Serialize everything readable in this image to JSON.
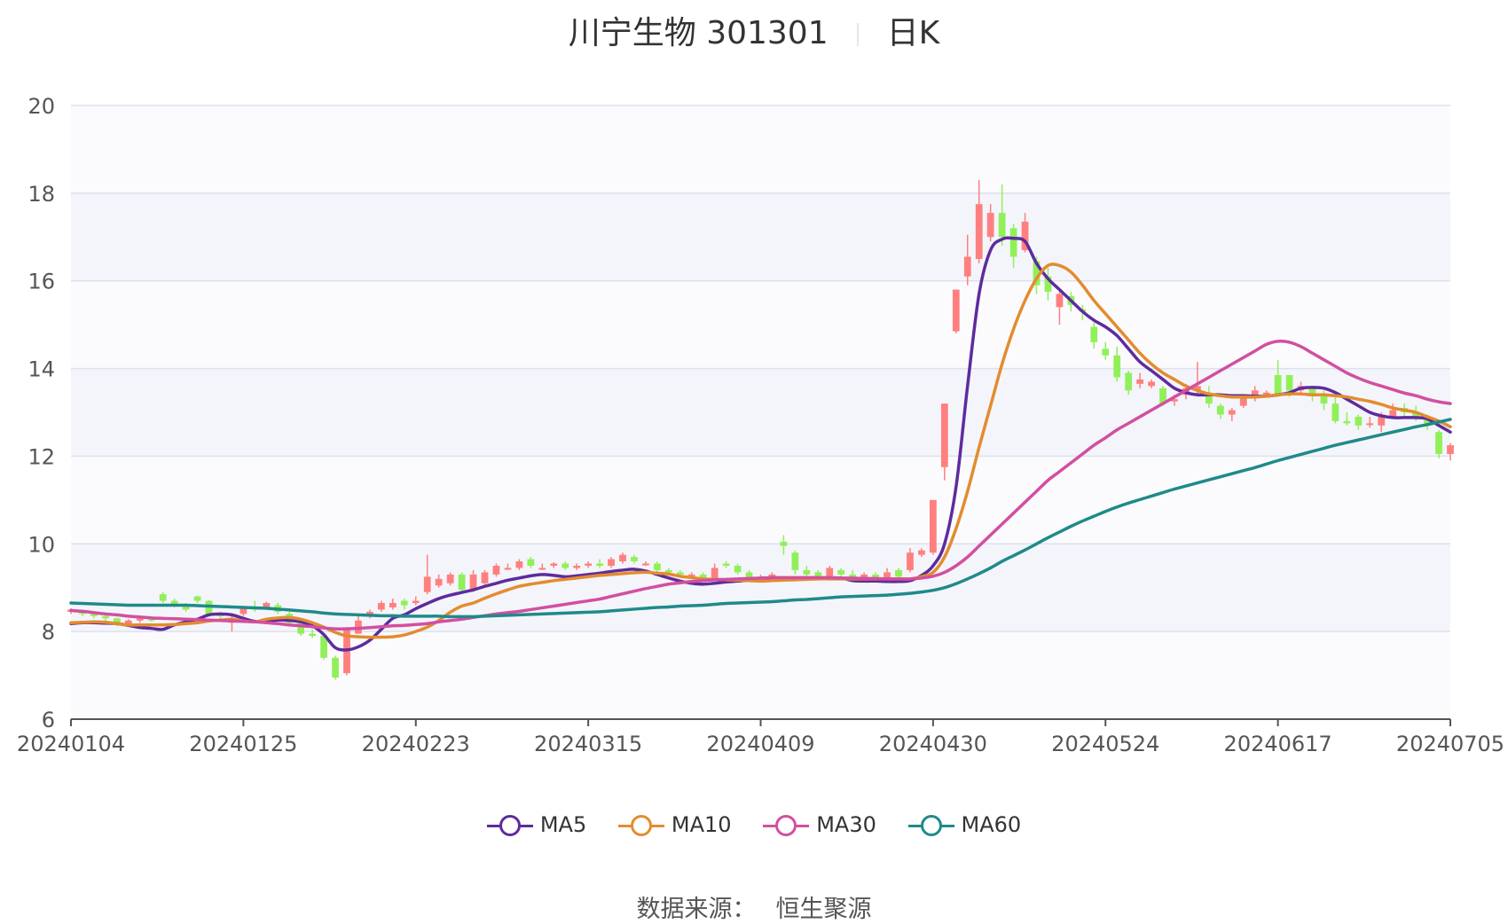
{
  "header": {
    "name": "川宁生物 301301",
    "period": "日K"
  },
  "source": {
    "label": "数据来源：",
    "value": "恒生聚源"
  },
  "colors": {
    "up": "#ff7f7f",
    "down": "#91f05a",
    "ma5": "#5e2b9e",
    "ma10": "#e38c2e",
    "ma30": "#d24fa0",
    "ma60": "#1f8a8a"
  },
  "chart_data": {
    "type": "candlestick",
    "title": "川宁生物 301301",
    "subtitle": "日K",
    "ylim": [
      6,
      20
    ],
    "yticks": [
      6,
      8,
      10,
      12,
      14,
      16,
      18,
      20
    ],
    "grid": true,
    "legend_position": "bottom",
    "x_tick_labels": [
      "20240104",
      "20240125",
      "20240223",
      "20240315",
      "20240409",
      "20240430",
      "20240524",
      "20240617",
      "20240705"
    ],
    "x_tick_index": [
      0,
      15,
      30,
      45,
      60,
      75,
      90,
      105,
      120
    ],
    "candles": [
      [
        8.45,
        8.5,
        8.4,
        8.53
      ],
      [
        8.45,
        8.4,
        8.35,
        8.48
      ],
      [
        8.4,
        8.35,
        8.3,
        8.43
      ],
      [
        8.35,
        8.3,
        8.25,
        8.4
      ],
      [
        8.3,
        8.15,
        8.12,
        8.32
      ],
      [
        8.15,
        8.25,
        8.1,
        8.28
      ],
      [
        8.25,
        8.3,
        8.2,
        8.33
      ],
      [
        8.3,
        8.25,
        8.22,
        8.32
      ],
      [
        8.85,
        8.7,
        8.65,
        8.9
      ],
      [
        8.7,
        8.6,
        8.55,
        8.75
      ],
      [
        8.6,
        8.5,
        8.45,
        8.65
      ],
      [
        8.8,
        8.7,
        8.65,
        8.82
      ],
      [
        8.7,
        8.4,
        8.35,
        8.72
      ],
      [
        8.4,
        8.35,
        8.3,
        8.45
      ],
      [
        8.2,
        8.3,
        8.0,
        8.35
      ],
      [
        8.4,
        8.55,
        8.35,
        8.58
      ],
      [
        8.55,
        8.5,
        8.45,
        8.7
      ],
      [
        8.55,
        8.65,
        8.5,
        8.68
      ],
      [
        8.6,
        8.45,
        8.4,
        8.65
      ],
      [
        8.4,
        8.2,
        8.15,
        8.45
      ],
      [
        8.2,
        7.95,
        7.9,
        8.25
      ],
      [
        7.95,
        7.9,
        7.85,
        8.05
      ],
      [
        7.9,
        7.4,
        7.35,
        7.95
      ],
      [
        7.4,
        6.95,
        6.9,
        7.45
      ],
      [
        7.05,
        8.05,
        7.0,
        8.1
      ],
      [
        7.95,
        8.25,
        7.95,
        8.4
      ],
      [
        8.35,
        8.45,
        8.3,
        8.5
      ],
      [
        8.5,
        8.65,
        8.45,
        8.7
      ],
      [
        8.55,
        8.65,
        8.5,
        8.75
      ],
      [
        8.7,
        8.6,
        8.5,
        8.75
      ],
      [
        8.65,
        8.7,
        8.6,
        8.8
      ],
      [
        8.9,
        9.25,
        8.85,
        9.75
      ],
      [
        9.05,
        9.2,
        9.0,
        9.3
      ],
      [
        9.1,
        9.3,
        9.05,
        9.35
      ],
      [
        9.3,
        8.95,
        8.9,
        9.35
      ],
      [
        8.95,
        9.3,
        8.9,
        9.4
      ],
      [
        9.1,
        9.35,
        9.05,
        9.4
      ],
      [
        9.3,
        9.5,
        9.25,
        9.55
      ],
      [
        9.45,
        9.45,
        9.4,
        9.55
      ],
      [
        9.45,
        9.6,
        9.4,
        9.65
      ],
      [
        9.65,
        9.5,
        9.45,
        9.7
      ],
      [
        9.45,
        9.45,
        9.4,
        9.55
      ],
      [
        9.5,
        9.55,
        9.45,
        9.58
      ],
      [
        9.55,
        9.45,
        9.4,
        9.6
      ],
      [
        9.45,
        9.5,
        9.4,
        9.55
      ],
      [
        9.5,
        9.55,
        9.45,
        9.6
      ],
      [
        9.55,
        9.5,
        9.45,
        9.65
      ],
      [
        9.5,
        9.65,
        9.45,
        9.7
      ],
      [
        9.6,
        9.75,
        9.55,
        9.8
      ],
      [
        9.7,
        9.6,
        9.55,
        9.75
      ],
      [
        9.55,
        9.55,
        9.5,
        9.6
      ],
      [
        9.55,
        9.4,
        9.35,
        9.6
      ],
      [
        9.4,
        9.35,
        9.3,
        9.45
      ],
      [
        9.35,
        9.3,
        9.25,
        9.4
      ],
      [
        9.3,
        9.3,
        9.25,
        9.35
      ],
      [
        9.3,
        9.2,
        9.15,
        9.35
      ],
      [
        9.2,
        9.45,
        9.15,
        9.55
      ],
      [
        9.55,
        9.5,
        9.45,
        9.6
      ],
      [
        9.5,
        9.35,
        9.3,
        9.55
      ],
      [
        9.35,
        9.2,
        9.15,
        9.4
      ],
      [
        9.2,
        9.25,
        9.15,
        9.3
      ],
      [
        9.2,
        9.3,
        9.15,
        9.35
      ],
      [
        10.05,
        9.95,
        9.75,
        10.2
      ],
      [
        9.8,
        9.4,
        9.3,
        9.85
      ],
      [
        9.4,
        9.3,
        9.25,
        9.5
      ],
      [
        9.35,
        9.25,
        9.2,
        9.4
      ],
      [
        9.25,
        9.45,
        9.2,
        9.5
      ],
      [
        9.4,
        9.3,
        9.25,
        9.45
      ],
      [
        9.3,
        9.2,
        9.15,
        9.4
      ],
      [
        9.2,
        9.3,
        9.15,
        9.35
      ],
      [
        9.3,
        9.2,
        9.15,
        9.35
      ],
      [
        9.2,
        9.35,
        9.15,
        9.45
      ],
      [
        9.4,
        9.25,
        9.2,
        9.45
      ],
      [
        9.4,
        9.8,
        9.35,
        9.9
      ],
      [
        9.75,
        9.85,
        9.7,
        9.9
      ],
      [
        9.8,
        11.0,
        9.75,
        11.0
      ],
      [
        11.75,
        13.2,
        11.45,
        13.2
      ],
      [
        14.85,
        15.8,
        14.8,
        15.8
      ],
      [
        16.1,
        16.55,
        15.9,
        17.05
      ],
      [
        16.5,
        17.75,
        16.4,
        18.3
      ],
      [
        17.0,
        17.55,
        16.9,
        17.75
      ],
      [
        17.55,
        17.0,
        16.8,
        18.2
      ],
      [
        17.2,
        16.55,
        16.3,
        17.3
      ],
      [
        16.7,
        17.35,
        16.65,
        17.55
      ],
      [
        16.45,
        15.9,
        15.7,
        16.55
      ],
      [
        16.1,
        15.75,
        15.55,
        16.3
      ],
      [
        15.4,
        15.7,
        15.0,
        15.75
      ],
      [
        15.65,
        15.45,
        15.3,
        15.75
      ],
      [
        15.35,
        15.3,
        15.1,
        15.45
      ],
      [
        14.95,
        14.6,
        14.45,
        15.05
      ],
      [
        14.45,
        14.3,
        14.2,
        14.6
      ],
      [
        14.3,
        13.8,
        13.7,
        14.5
      ],
      [
        13.9,
        13.5,
        13.4,
        13.95
      ],
      [
        13.65,
        13.75,
        13.55,
        13.9
      ],
      [
        13.6,
        13.7,
        13.55,
        13.75
      ],
      [
        13.55,
        13.2,
        13.15,
        13.6
      ],
      [
        13.25,
        13.3,
        13.15,
        13.4
      ],
      [
        13.4,
        13.55,
        13.3,
        13.65
      ],
      [
        13.5,
        13.6,
        13.4,
        14.15
      ],
      [
        13.45,
        13.2,
        13.1,
        13.6
      ],
      [
        13.15,
        12.95,
        12.85,
        13.2
      ],
      [
        12.95,
        13.05,
        12.8,
        13.1
      ],
      [
        13.15,
        13.35,
        13.1,
        13.4
      ],
      [
        13.35,
        13.5,
        13.25,
        13.6
      ],
      [
        13.4,
        13.45,
        13.35,
        13.5
      ],
      [
        13.85,
        13.4,
        13.35,
        14.2
      ],
      [
        13.85,
        13.5,
        13.35,
        13.85
      ],
      [
        13.5,
        13.6,
        13.4,
        13.7
      ],
      [
        13.55,
        13.4,
        13.25,
        13.6
      ],
      [
        13.4,
        13.2,
        13.05,
        13.5
      ],
      [
        13.2,
        12.8,
        12.75,
        13.4
      ],
      [
        12.8,
        12.75,
        12.7,
        13.0
      ],
      [
        12.9,
        12.7,
        12.6,
        12.95
      ],
      [
        12.75,
        12.75,
        12.65,
        12.9
      ],
      [
        12.7,
        12.95,
        12.55,
        13.0
      ],
      [
        12.9,
        13.05,
        12.85,
        13.2
      ],
      [
        13.1,
        13.0,
        12.9,
        13.2
      ],
      [
        13.0,
        12.85,
        12.8,
        13.15
      ],
      [
        12.85,
        12.7,
        12.6,
        12.95
      ],
      [
        12.55,
        12.05,
        11.95,
        12.6
      ],
      [
        12.05,
        12.25,
        11.9,
        12.3
      ]
    ],
    "series": [
      {
        "name": "MA5",
        "values": [
          8.18,
          8.2,
          8.2,
          8.19,
          8.18,
          8.14,
          8.09,
          8.07,
          8.05,
          8.15,
          8.22,
          8.28,
          8.38,
          8.4,
          8.38,
          8.3,
          8.23,
          8.23,
          8.26,
          8.25,
          8.22,
          8.13,
          7.93,
          7.63,
          7.58,
          7.65,
          7.8,
          8.05,
          8.3,
          8.38,
          8.52,
          8.64,
          8.75,
          8.83,
          8.89,
          8.95,
          9.03,
          9.1,
          9.17,
          9.22,
          9.27,
          9.3,
          9.28,
          9.25,
          9.27,
          9.3,
          9.33,
          9.37,
          9.4,
          9.42,
          9.38,
          9.3,
          9.22,
          9.15,
          9.1,
          9.08,
          9.1,
          9.13,
          9.15,
          9.17,
          9.18,
          9.2,
          9.22,
          9.22,
          9.22,
          9.22,
          9.22,
          9.22,
          9.16,
          9.15,
          9.15,
          9.14,
          9.14,
          9.16,
          9.28,
          9.5,
          10.0,
          11.3,
          13.6,
          15.7,
          16.7,
          16.95,
          16.97,
          16.9,
          16.4,
          16.05,
          15.8,
          15.55,
          15.3,
          15.1,
          14.95,
          14.75,
          14.45,
          14.15,
          13.95,
          13.75,
          13.55,
          13.45,
          13.4,
          13.4,
          13.4,
          13.38,
          13.38,
          13.37,
          13.37,
          13.4,
          13.45,
          13.55,
          13.57,
          13.55,
          13.45,
          13.3,
          13.15,
          13.0,
          12.92,
          12.88,
          12.88,
          12.88,
          12.85,
          12.7,
          12.55
        ]
      },
      {
        "name": "MA10",
        "values": [
          8.2,
          8.21,
          8.22,
          8.21,
          8.18,
          8.15,
          8.15,
          8.15,
          8.15,
          8.16,
          8.18,
          8.2,
          8.24,
          8.26,
          8.28,
          8.24,
          8.22,
          8.28,
          8.31,
          8.32,
          8.28,
          8.2,
          8.1,
          7.98,
          7.9,
          7.88,
          7.87,
          7.87,
          7.88,
          7.92,
          8.0,
          8.1,
          8.25,
          8.44,
          8.58,
          8.65,
          8.76,
          8.86,
          8.95,
          9.03,
          9.08,
          9.12,
          9.16,
          9.19,
          9.22,
          9.25,
          9.28,
          9.3,
          9.32,
          9.34,
          9.35,
          9.33,
          9.31,
          9.26,
          9.23,
          9.2,
          9.19,
          9.18,
          9.17,
          9.16,
          9.15,
          9.16,
          9.17,
          9.18,
          9.19,
          9.2,
          9.2,
          9.2,
          9.2,
          9.2,
          9.2,
          9.2,
          9.2,
          9.2,
          9.25,
          9.35,
          9.7,
          10.35,
          11.2,
          12.2,
          13.15,
          14.1,
          14.9,
          15.55,
          16.05,
          16.35,
          16.35,
          16.2,
          15.9,
          15.55,
          15.25,
          14.95,
          14.65,
          14.35,
          14.1,
          13.9,
          13.75,
          13.6,
          13.5,
          13.42,
          13.38,
          13.35,
          13.35,
          13.35,
          13.37,
          13.4,
          13.42,
          13.42,
          13.4,
          13.4,
          13.38,
          13.35,
          13.3,
          13.25,
          13.18,
          13.1,
          13.05,
          13.0,
          12.9,
          12.8,
          12.67
        ]
      },
      {
        "name": "MA30",
        "values": [
          8.48,
          8.46,
          8.43,
          8.4,
          8.38,
          8.35,
          8.33,
          8.31,
          8.3,
          8.29,
          8.28,
          8.27,
          8.26,
          8.25,
          8.24,
          8.23,
          8.22,
          8.2,
          8.18,
          8.15,
          8.13,
          8.11,
          8.08,
          8.06,
          8.06,
          8.07,
          8.09,
          8.11,
          8.13,
          8.14,
          8.16,
          8.18,
          8.22,
          8.25,
          8.28,
          8.32,
          8.36,
          8.4,
          8.43,
          8.46,
          8.5,
          8.54,
          8.58,
          8.62,
          8.66,
          8.7,
          8.74,
          8.8,
          8.86,
          8.92,
          8.98,
          9.03,
          9.08,
          9.11,
          9.14,
          9.16,
          9.18,
          9.19,
          9.2,
          9.21,
          9.22,
          9.23,
          9.23,
          9.23,
          9.23,
          9.23,
          9.23,
          9.22,
          9.22,
          9.21,
          9.21,
          9.2,
          9.2,
          9.2,
          9.22,
          9.26,
          9.35,
          9.5,
          9.7,
          9.95,
          10.2,
          10.45,
          10.7,
          10.95,
          11.2,
          11.45,
          11.65,
          11.85,
          12.05,
          12.25,
          12.42,
          12.6,
          12.75,
          12.9,
          13.05,
          13.2,
          13.35,
          13.5,
          13.65,
          13.8,
          13.95,
          14.1,
          14.25,
          14.4,
          14.55,
          14.62,
          14.6,
          14.5,
          14.35,
          14.2,
          14.05,
          13.9,
          13.78,
          13.68,
          13.6,
          13.52,
          13.44,
          13.38,
          13.3,
          13.24,
          13.2
        ]
      },
      {
        "name": "MA60",
        "values": [
          8.65,
          8.64,
          8.63,
          8.62,
          8.61,
          8.6,
          8.6,
          8.6,
          8.6,
          8.6,
          8.6,
          8.59,
          8.58,
          8.57,
          8.56,
          8.55,
          8.54,
          8.53,
          8.51,
          8.49,
          8.47,
          8.45,
          8.42,
          8.4,
          8.39,
          8.38,
          8.37,
          8.36,
          8.36,
          8.35,
          8.35,
          8.35,
          8.35,
          8.34,
          8.34,
          8.34,
          8.35,
          8.36,
          8.37,
          8.38,
          8.39,
          8.4,
          8.41,
          8.42,
          8.43,
          8.44,
          8.45,
          8.47,
          8.49,
          8.51,
          8.53,
          8.55,
          8.56,
          8.58,
          8.59,
          8.6,
          8.62,
          8.64,
          8.65,
          8.66,
          8.67,
          8.68,
          8.7,
          8.72,
          8.73,
          8.75,
          8.77,
          8.79,
          8.8,
          8.81,
          8.82,
          8.83,
          8.85,
          8.87,
          8.9,
          8.94,
          9.0,
          9.09,
          9.2,
          9.32,
          9.45,
          9.6,
          9.73,
          9.86,
          10.0,
          10.14,
          10.27,
          10.4,
          10.52,
          10.63,
          10.74,
          10.84,
          10.93,
          11.01,
          11.09,
          11.17,
          11.25,
          11.32,
          11.39,
          11.46,
          11.53,
          11.6,
          11.67,
          11.74,
          11.82,
          11.9,
          11.97,
          12.04,
          12.11,
          12.18,
          12.25,
          12.31,
          12.37,
          12.43,
          12.49,
          12.55,
          12.61,
          12.67,
          12.72,
          12.78,
          12.84
        ]
      }
    ]
  }
}
